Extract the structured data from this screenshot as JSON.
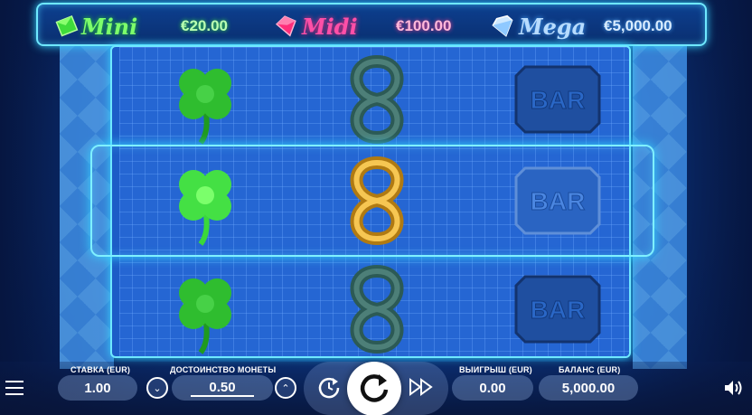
{
  "jackpots": [
    {
      "name": "Mini",
      "value": "€20.00",
      "color": "#7dff6b",
      "gem": "green-gem-icon"
    },
    {
      "name": "Midi",
      "value": "€100.00",
      "color": "#ff4fa8",
      "gem": "pink-gem-icon"
    },
    {
      "name": "Mega",
      "value": "€5,000.00",
      "color": "#9fd8ff",
      "gem": "blue-gem-icon"
    }
  ],
  "reels": [
    {
      "symbols": [
        "clover",
        "clover",
        "clover"
      ]
    },
    {
      "symbols": [
        "celtic-knot",
        "celtic-knot-gold",
        "celtic-knot"
      ]
    },
    {
      "symbols": [
        "bar",
        "bar",
        "bar"
      ]
    }
  ],
  "bar_symbol_text": "BAR",
  "controls": {
    "bet_label": "СТАВКА (EUR)",
    "bet_value": "1.00",
    "coin_label": "ДОСТОИНСТВО МОНЕТЫ",
    "coin_value": "0.50",
    "win_label": "ВЫИГРЫШ (EUR)",
    "win_value": "0.00",
    "balance_label": "БАЛАНС (EUR)",
    "balance_value": "5,000.00"
  },
  "icons": {
    "menu": "menu-icon",
    "autoplay": "autoplay-icon",
    "spin": "spin-icon",
    "turbo": "fast-forward-icon",
    "sound": "speaker-icon",
    "coin_down": "chevron-down-icon",
    "coin_up": "chevron-up-icon"
  }
}
